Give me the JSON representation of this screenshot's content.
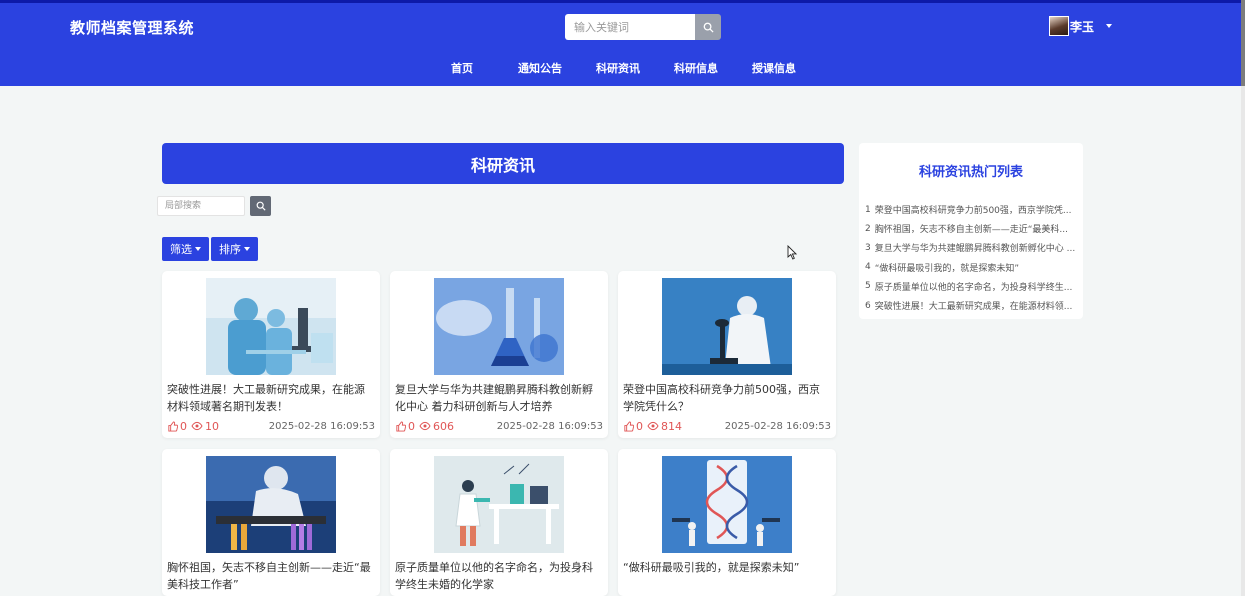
{
  "header": {
    "brand": "教师档案管理系统",
    "search": {
      "placeholder": "输入关键词",
      "value": ""
    },
    "user": {
      "name": "李玉"
    },
    "nav": [
      {
        "label": "首页"
      },
      {
        "label": "通知公告"
      },
      {
        "label": "科研资讯"
      },
      {
        "label": "科研信息"
      },
      {
        "label": "授课信息"
      }
    ]
  },
  "main": {
    "banner_title": "科研资讯",
    "local_search_placeholder": "局部搜索",
    "filter_label": "筛选",
    "sort_label": "排序",
    "cards": [
      {
        "title": "突破性进展！大工最新研究成果，在能源材料领域著名期刊发表！",
        "likes": "0",
        "views": "10",
        "date": "2025-02-28 16:09:53"
      },
      {
        "title": "复旦大学与华为共建鲲鹏昇腾科教创新孵化中心 着力科研创新与人才培养",
        "likes": "0",
        "views": "606",
        "date": "2025-02-28 16:09:53"
      },
      {
        "title": "荣登中国高校科研竞争力前500强，西京学院凭什么？",
        "likes": "0",
        "views": "814",
        "date": "2025-02-28 16:09:53"
      },
      {
        "title": "胸怀祖国，矢志不移自主创新——走近“最美科技工作者”"
      },
      {
        "title": "原子质量单位以他的名字命名，为投身科学终生未婚的化学家"
      },
      {
        "title": "“做科研最吸引我的，就是探索未知”"
      }
    ]
  },
  "sidebar": {
    "title": "科研资讯热门列表",
    "items": [
      {
        "num": "1",
        "text": "荣登中国高校科研竞争力前500强，西京学院凭..."
      },
      {
        "num": "2",
        "text": "胸怀祖国，矢志不移自主创新——走近“最美科..."
      },
      {
        "num": "3",
        "text": "复旦大学与华为共建鲲鹏昇腾科教创新孵化中心 ..."
      },
      {
        "num": "4",
        "text": "“做科研最吸引我的，就是探索未知”"
      },
      {
        "num": "5",
        "text": "原子质量单位以他的名字命名，为投身科学终生..."
      },
      {
        "num": "6",
        "text": "突破性进展！大工最新研究成果，在能源材料领..."
      }
    ]
  },
  "colors": {
    "primary": "#2b42e0",
    "danger": "#e05656",
    "background": "#f3f6f6"
  }
}
